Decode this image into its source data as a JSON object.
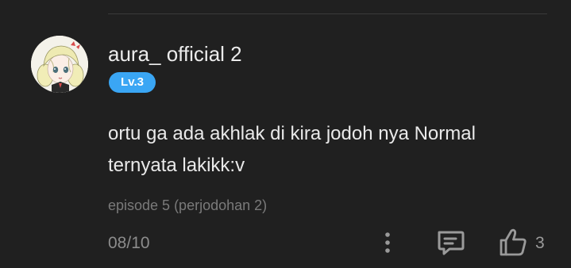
{
  "comment": {
    "username": "aura_ official 2",
    "level": "Lv.3",
    "text_lines": [
      "ortu ga ada akhlak di kira jodoh nya Normal",
      "ternyata lakikk:v"
    ],
    "episode": "episode 5 (perjodohan 2)",
    "date": "08/10",
    "like_count": "3"
  },
  "icons": {
    "more": "more-vertical-icon",
    "comment": "comment-bubble-icon",
    "like": "thumbs-up-icon"
  },
  "colors": {
    "background": "#202020",
    "badge": "#3aa6f4",
    "text_primary": "#e9e9e9",
    "text_secondary": "#8c8c8c"
  }
}
